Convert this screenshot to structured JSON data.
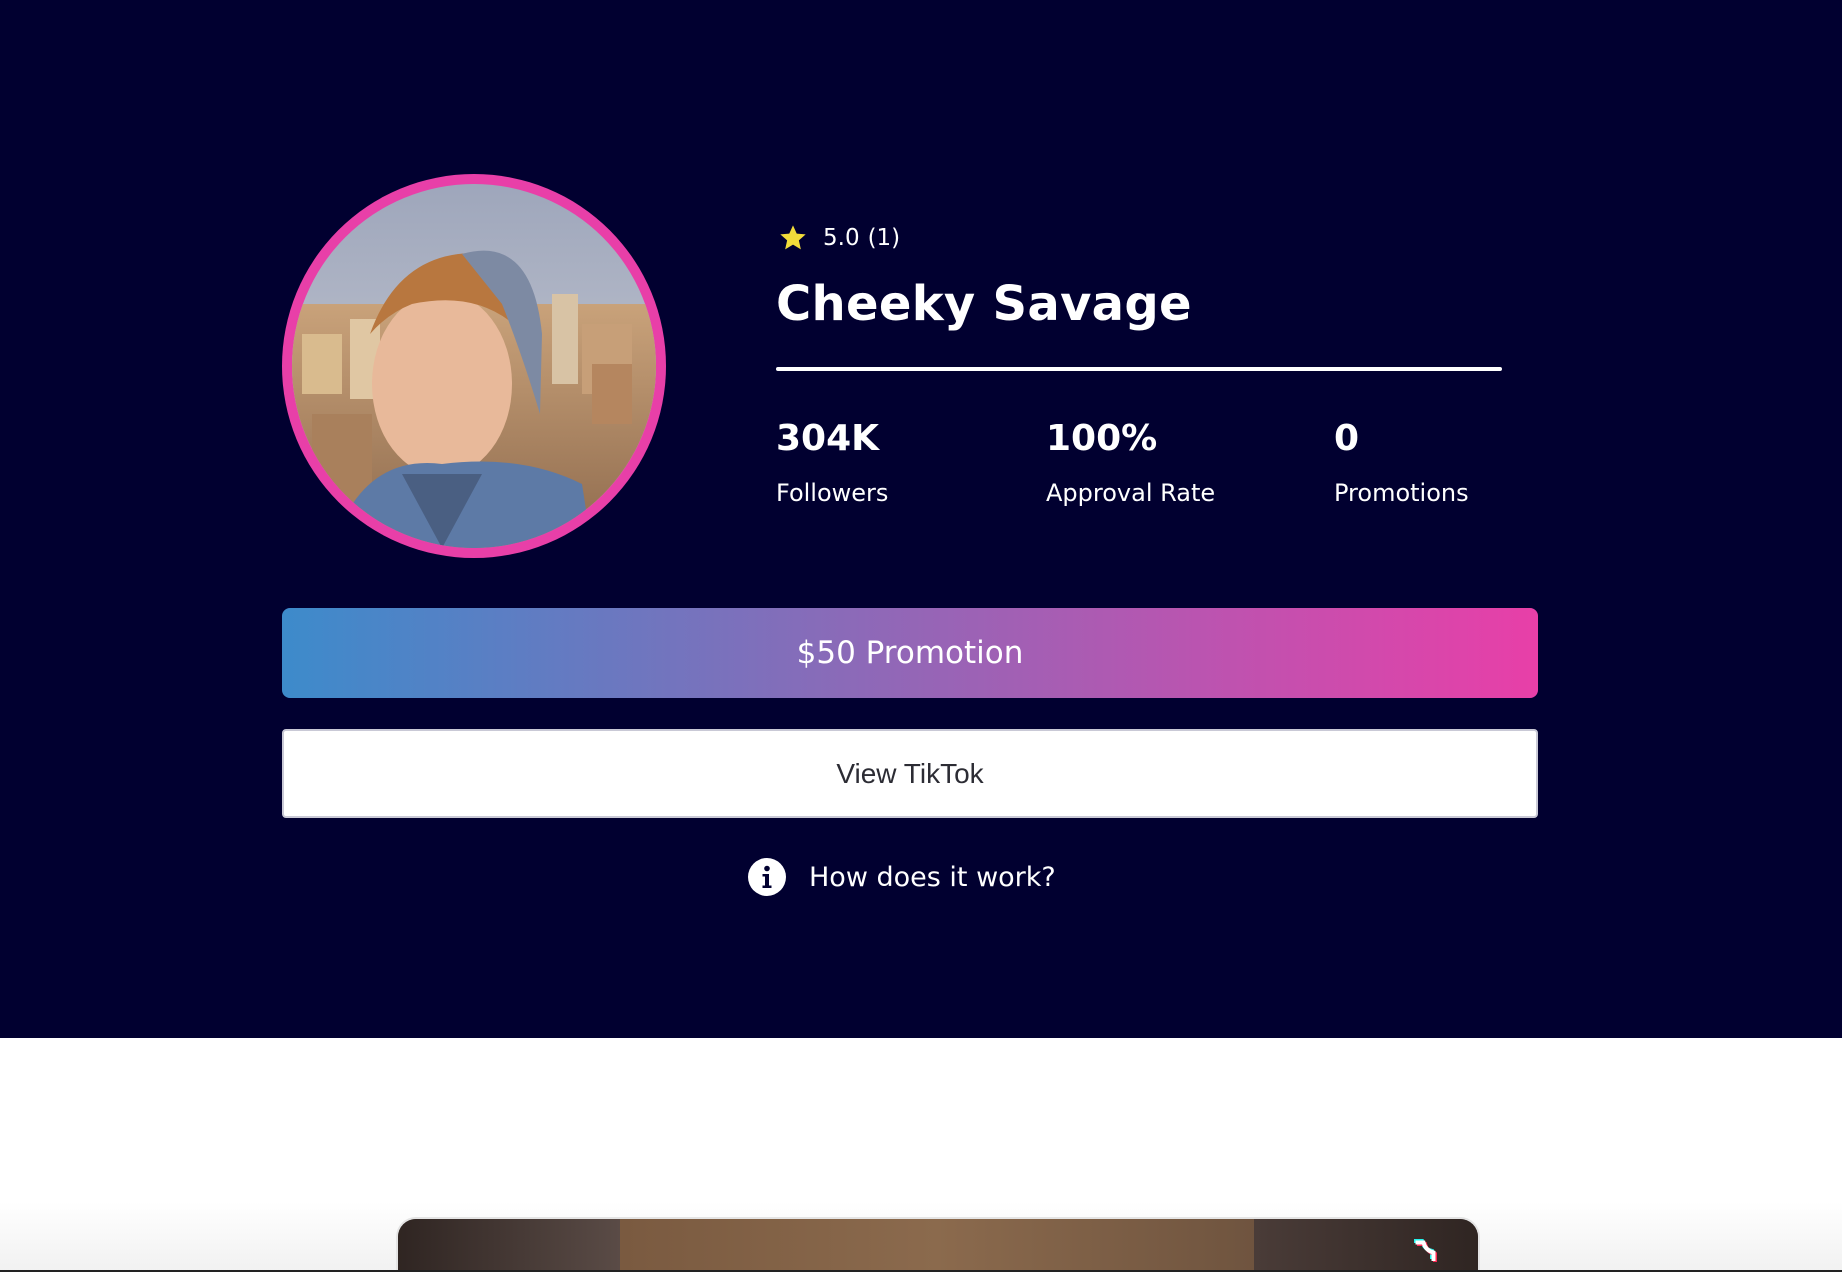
{
  "profile": {
    "name": "Cheeky Savage",
    "rating_value": "5.0",
    "rating_count": "(1)",
    "avatar_alt": ""
  },
  "stats": [
    {
      "value": "304K",
      "label": "Followers"
    },
    {
      "value": "100%",
      "label": "Approval Rate"
    },
    {
      "value": "0",
      "label": "Promotions"
    }
  ],
  "actions": {
    "promotion_label": "$50 Promotion",
    "view_tiktok_label": "View TikTok",
    "how_label": "How does it work?"
  },
  "icons": {
    "rating": "star-icon",
    "how": "info-icon",
    "video": "tiktok-icon"
  },
  "colors": {
    "background": "#010030",
    "accent_pink": "#e83fa8",
    "accent_blue": "#3d8bcb",
    "star": "#f2dc3a"
  }
}
